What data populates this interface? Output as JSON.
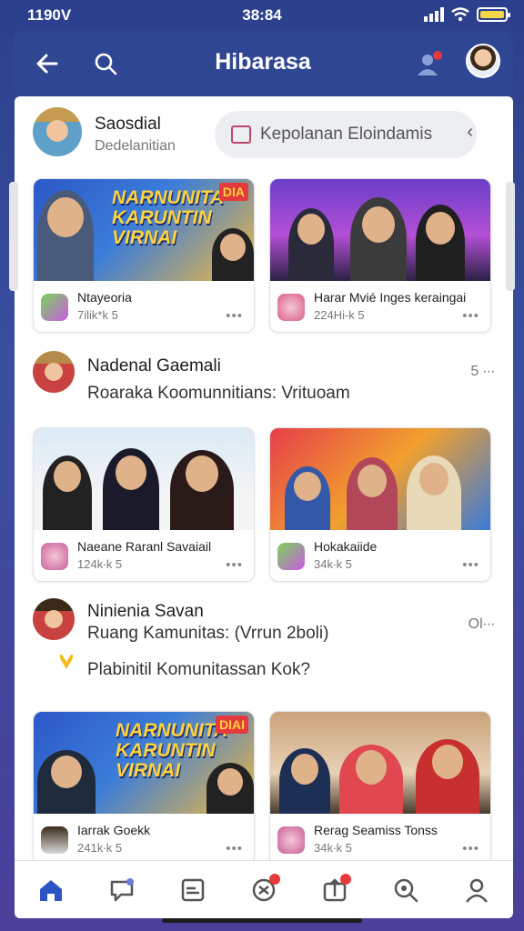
{
  "status": {
    "time_left": "1190V",
    "time_center": "38:84"
  },
  "header": {
    "title": "Hibarasa"
  },
  "profile": {
    "name": "Saosdial",
    "subtitle": "Dedelanitian"
  },
  "search_pill": {
    "text": "Kepolanan Eloindamis"
  },
  "row1": [
    {
      "banner": "NARNUNITA\nKARUNTIN\nVIRNAI",
      "tag": "DIA",
      "title": "Ntayeoria",
      "stats": "7ilik*k 5"
    },
    {
      "title": "Harar Mvié Inges keraingai",
      "stats": "224Hi-k 5"
    }
  ],
  "post1": {
    "name": "Nadenal Gaemali",
    "text": "Roaraka Koomunnitians: Vrituoam",
    "more": "5 ∙∙∙"
  },
  "row2": [
    {
      "title": "Naeane Raranl Savaiail",
      "stats": "124k∙k 5"
    },
    {
      "title": "Hokakaiide",
      "stats": "34k∙k 5"
    }
  ],
  "post2": {
    "name": "Ninienia Savan",
    "text1": "Ruang Kamunitas: (Vrrun 2boli)",
    "text2": "Plabinitil Komunitassan Kok?",
    "more": "Ol∙∙∙"
  },
  "row3": [
    {
      "banner": "NARNUNITA\nKARUNTIN\nVIRNAI",
      "tag": "DIAI",
      "title": "Iarrak Goekk",
      "stats": "241k∙k 5"
    },
    {
      "title": "Rerag Seamiss Tonss",
      "stats": "34k∙k 5"
    }
  ],
  "icons": {
    "back": "arrow-left-icon",
    "search": "search-icon",
    "user": "user-icon",
    "home": "home-icon",
    "chat": "chat-icon",
    "media": "media-icon",
    "games": "games-icon",
    "share": "share-icon",
    "explore": "explore-icon",
    "profile": "profile-icon"
  }
}
